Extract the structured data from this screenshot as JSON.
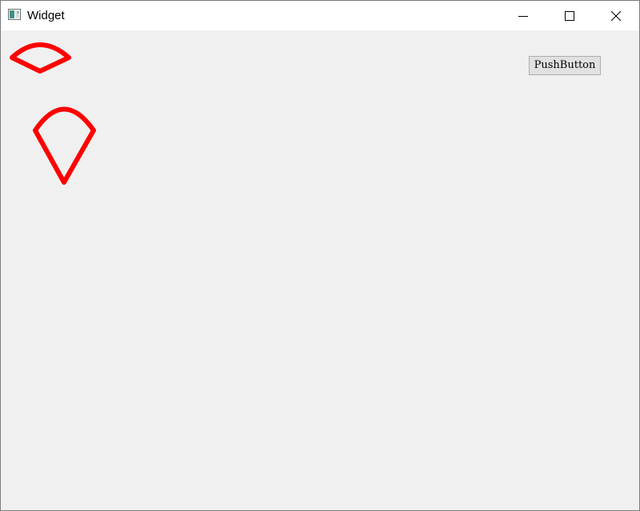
{
  "window": {
    "title": "Widget",
    "app_icon": "app-window-icon",
    "controls": {
      "minimize_icon": "minimize-icon",
      "maximize_icon": "maximize-icon",
      "close_icon": "close-icon"
    }
  },
  "content": {
    "push_button_label": "PushButton",
    "stroke_color": "#ff0000"
  },
  "colors": {
    "titlebar": "#ffffff",
    "client": "#f0f0f0",
    "button_face": "#e1e1e1",
    "button_border": "#adadad"
  }
}
